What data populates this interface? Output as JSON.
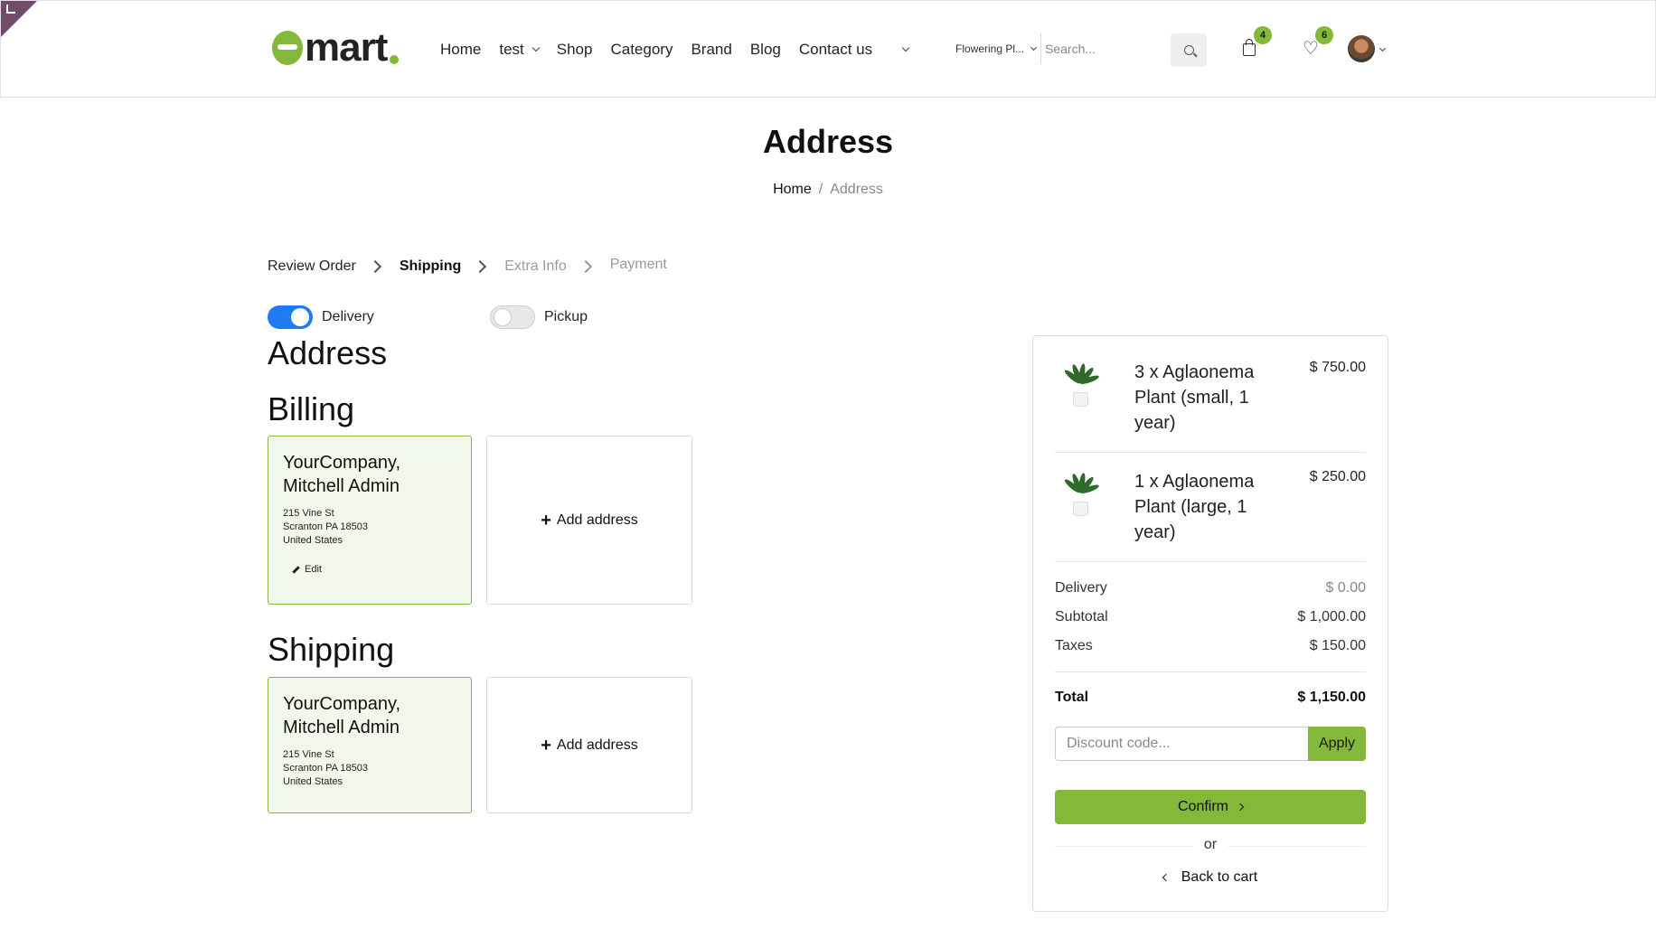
{
  "header": {
    "logo_text": "mart",
    "nav": [
      "Home",
      "test",
      "Shop",
      "Category",
      "Brand",
      "Blog",
      "Contact us"
    ],
    "search_category": "Flowering Pl...",
    "search_placeholder": "Search...",
    "cart_count": "4",
    "wishlist_count": "6",
    "icons": {
      "search": "search-icon",
      "cart": "cart-icon",
      "wishlist": "heart-icon",
      "avatar": "user-avatar"
    },
    "accent_color": "#84b83b"
  },
  "page": {
    "title": "Address",
    "breadcrumb": {
      "home": "Home",
      "separator": "/",
      "current": "Address"
    }
  },
  "steps": [
    {
      "label": "Review Order",
      "state": "done"
    },
    {
      "label": "Shipping",
      "state": "active"
    },
    {
      "label": "Extra Info",
      "state": "todo"
    },
    {
      "label": "Payment",
      "state": "todo"
    }
  ],
  "delivery": {
    "delivery_label": "Delivery",
    "delivery_on": true,
    "pickup_label": "Pickup",
    "pickup_on": false
  },
  "address": {
    "heading": "Address",
    "billing": {
      "heading": "Billing",
      "card": {
        "name": "YourCompany, Mitchell Admin",
        "line1": "215 Vine St",
        "line2": "Scranton PA 18503",
        "line3": "United States",
        "edit_label": "Edit"
      },
      "add_label": "Add address"
    },
    "shipping": {
      "heading": "Shipping",
      "card": {
        "name": "YourCompany, Mitchell Admin",
        "line1": "215 Vine St",
        "line2": "Scranton PA 18503",
        "line3": "United States"
      },
      "add_label": "Add address"
    }
  },
  "summary": {
    "items": [
      {
        "name": "3 x Aglaonema Plant (small, 1 year)",
        "price": "$ 750.00"
      },
      {
        "name": "1 x Aglaonema Plant (large, 1 year)",
        "price": "$ 250.00"
      }
    ],
    "delivery_label": "Delivery",
    "delivery_value": "$ 0.00",
    "subtotal_label": "Subtotal",
    "subtotal_value": "$ 1,000.00",
    "taxes_label": "Taxes",
    "taxes_value": "$ 150.00",
    "total_label": "Total",
    "total_value": "$ 1,150.00",
    "discount_placeholder": "Discount code...",
    "apply_label": "Apply",
    "confirm_label": "Confirm",
    "or_label": "or",
    "back_label": "Back to cart"
  }
}
